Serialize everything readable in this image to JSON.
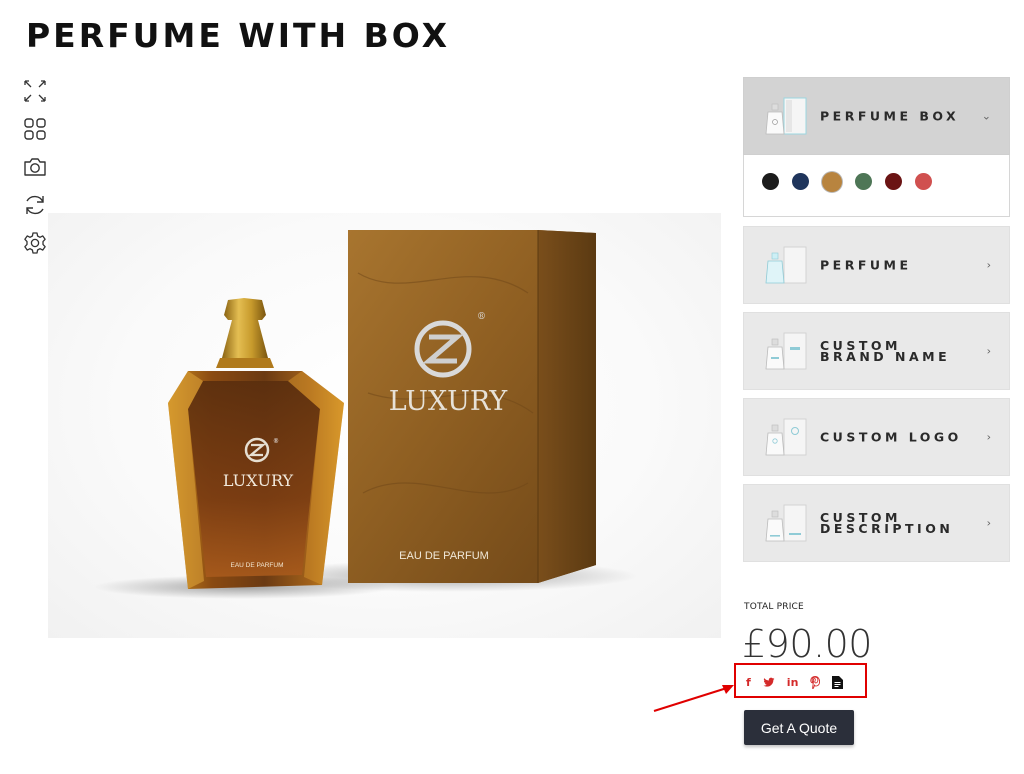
{
  "page": {
    "title": "PERFUME WITH BOX"
  },
  "toolbar": {
    "items": [
      {
        "icon": "expand-icon"
      },
      {
        "icon": "grid-icon"
      },
      {
        "icon": "camera-icon"
      },
      {
        "icon": "rotate-icon"
      },
      {
        "icon": "gear-icon"
      }
    ]
  },
  "product_image": {
    "bottle_brand": "LUXURY",
    "bottle_subtitle": "EAU DE PARFUM",
    "box_brand": "LUXURY",
    "box_subtitle": "EAU DE PARFUM",
    "registered_mark": "®"
  },
  "options": [
    {
      "label": "PERFUME BOX",
      "chevron": "⌄",
      "active": true
    },
    {
      "label": "PERFUME",
      "chevron": "›"
    },
    {
      "label": "CUSTOM BRAND NAME",
      "chevron": "›"
    },
    {
      "label": "CUSTOM LOGO",
      "chevron": "›"
    },
    {
      "label": "CUSTOM DESCRIPTION",
      "chevron": "›"
    }
  ],
  "swatches": [
    "#1c1c1c",
    "#1f355c",
    "#b8843f",
    "#4e7656",
    "#6b1414",
    "#d0504f"
  ],
  "selected_swatch_index": 2,
  "price": {
    "label": "TOTAL PRICE",
    "value": "£90.00"
  },
  "share": {
    "facebook": "f",
    "twitter": "twitter-icon",
    "linkedin": "in",
    "pinterest": "pinterest-icon",
    "pdf": "document-icon"
  },
  "annotation_color": "#e00000",
  "cta": {
    "label": "Get A Quote"
  }
}
